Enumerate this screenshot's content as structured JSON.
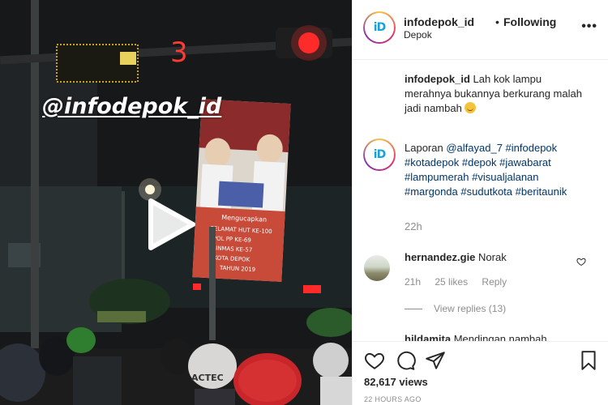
{
  "video": {
    "overlay_tag": "@infodepok_id",
    "countdown_digit": "3",
    "billboard_lines": [
      "Mengucapkan",
      "SELAMAT HUT KE-100",
      "POL PP KE-69",
      "LINMAS KE-57",
      "KOTA DEPOK",
      "TAHUN 2019"
    ],
    "helmet_text": "ACTEC"
  },
  "header": {
    "avatar_logo": "iD",
    "username": "infodepok_id",
    "separator": "•",
    "follow_status": "Following",
    "location": "Depok",
    "more_label": "•••"
  },
  "caption": {
    "username": "infodepok_id",
    "text": "Lah kok lampu merahnya bukannya berkurang malah jadi nambah"
  },
  "reply_comment": {
    "intro": "Laporan",
    "mention": "@alfayad_7",
    "hashtags": [
      "#infodepok",
      "#kotadepok",
      "#depok",
      "#jawabarat",
      "#lampumerah",
      "#visualjalanan",
      "#margonda",
      "#sudutkota",
      "#beritaunik"
    ],
    "time": "22h"
  },
  "comments": [
    {
      "username": "hernandez.gie",
      "text": "Norak",
      "time": "21h",
      "likes": "25 likes",
      "reply_label": "Reply",
      "view_replies": "View replies (13)"
    },
    {
      "username": "hildamita",
      "text": "Mendingan nambah"
    }
  ],
  "stats": {
    "views": "82,617 views",
    "posted_ago": "22 HOURS AGO"
  },
  "colors": {
    "link": "#003569",
    "muted": "#8e8e8e",
    "text": "#262626",
    "traffic_red": "#ff2a2a"
  }
}
